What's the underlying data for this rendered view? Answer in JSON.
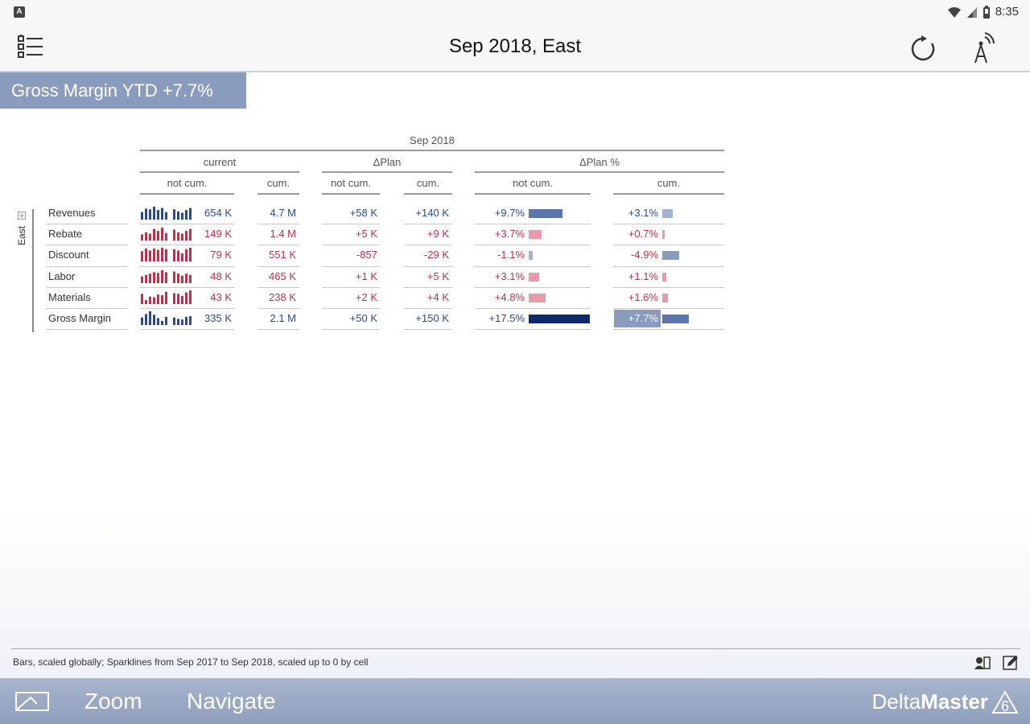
{
  "status": {
    "time": "8:35",
    "app_icon": "A"
  },
  "header": {
    "title": "Sep 2018, East"
  },
  "kpi": {
    "label": "Gross Margin YTD +7.7%"
  },
  "table": {
    "period": "Sep 2018",
    "groups": [
      "current",
      "ΔPlan",
      "ΔPlan %"
    ],
    "subheaders": [
      "not cum.",
      "cum.",
      "not cum.",
      "cum.",
      "not cum.",
      "cum."
    ],
    "dimension": "East",
    "rows": [
      {
        "label": "Revenues",
        "cur": "654 K",
        "cum": "4.7 M",
        "dp": "+58 K",
        "dpc": "+140 K",
        "pct": "+9.7%",
        "pctc": "+3.1%",
        "pct_val": 9.7,
        "pctc_val": 3.1,
        "color": "blue",
        "spark": [
          0.55,
          0.8,
          0.75,
          0.95,
          0.7,
          0.85,
          0.55,
          0.05,
          0.75,
          0.6,
          0.5,
          0.7,
          0.85
        ]
      },
      {
        "label": "Rebate",
        "cur": "149 K",
        "cum": "1.4 M",
        "dp": "+5 K",
        "dpc": "+9 K",
        "pct": "+3.7%",
        "pctc": "+0.7%",
        "pct_val": 3.7,
        "pctc_val": 0.7,
        "color": "red",
        "spark": [
          0.45,
          0.6,
          0.5,
          0.85,
          0.7,
          0.95,
          0.55,
          0.05,
          0.8,
          0.6,
          0.5,
          0.7,
          0.85
        ]
      },
      {
        "label": "Discount",
        "cur": "79 K",
        "cum": "551 K",
        "dp": "-857",
        "dpc": "-29 K",
        "pct": "-1.1%",
        "pctc": "-4.9%",
        "pct_val": -1.1,
        "pctc_val": -4.9,
        "color": "red",
        "spark": [
          0.75,
          0.95,
          0.8,
          0.95,
          0.85,
          1.0,
          0.9,
          0.05,
          0.9,
          0.8,
          0.6,
          0.9,
          1.0
        ]
      },
      {
        "label": "Labor",
        "cur": "48 K",
        "cum": "465 K",
        "dp": "+1 K",
        "dpc": "+5 K",
        "pct": "+3.1%",
        "pctc": "+1.1%",
        "pct_val": 3.1,
        "pctc_val": 1.1,
        "color": "red",
        "spark": [
          0.5,
          0.6,
          0.7,
          0.8,
          0.75,
          0.95,
          0.8,
          0.05,
          0.85,
          0.7,
          0.55,
          0.7,
          0.6
        ]
      },
      {
        "label": "Materials",
        "cur": "43 K",
        "cum": "238 K",
        "dp": "+2 K",
        "dpc": "+4 K",
        "pct": "+4.8%",
        "pctc": "+1.6%",
        "pct_val": 4.8,
        "pctc_val": 1.6,
        "color": "red",
        "spark": [
          0.75,
          0.3,
          0.55,
          0.5,
          0.7,
          0.65,
          0.9,
          0.05,
          0.8,
          0.75,
          0.6,
          0.85,
          1.0
        ]
      },
      {
        "label": "Gross Margin",
        "cur": "335 K",
        "cum": "2.1 M",
        "dp": "+50 K",
        "dpc": "+150 K",
        "pct": "+17.5%",
        "pctc": "+7.7%",
        "pct_val": 17.5,
        "pctc_val": 7.7,
        "color": "blue",
        "spark": [
          0.55,
          0.8,
          1.0,
          0.75,
          0.5,
          0.3,
          0.6,
          0.05,
          0.55,
          0.45,
          0.4,
          0.6,
          0.65
        ]
      }
    ]
  },
  "footer": {
    "note": "Bars, scaled globally; Sparklines from Sep 2017 to Sep 2018, scaled up to 0 by cell"
  },
  "bottom": {
    "zoom": "Zoom",
    "navigate": "Navigate",
    "brand_light": "Delta",
    "brand_bold": "Master",
    "brand_version": "6"
  },
  "colors": {
    "accent": "#8a9cbd",
    "blue": "#2a4a8c",
    "red": "#c0304a",
    "bar_blue": "#5a76ad",
    "bar_light": "#a3b4d3",
    "bar_red": "#e89aa8",
    "bar_dark": "#0b2a6b"
  },
  "icons": [
    "menu-icon",
    "refresh-icon",
    "antenna-icon",
    "wifi-icon",
    "signal-icon",
    "battery-icon",
    "expand-icon",
    "user-note-icon",
    "edit-icon",
    "zoom-frame-icon"
  ]
}
